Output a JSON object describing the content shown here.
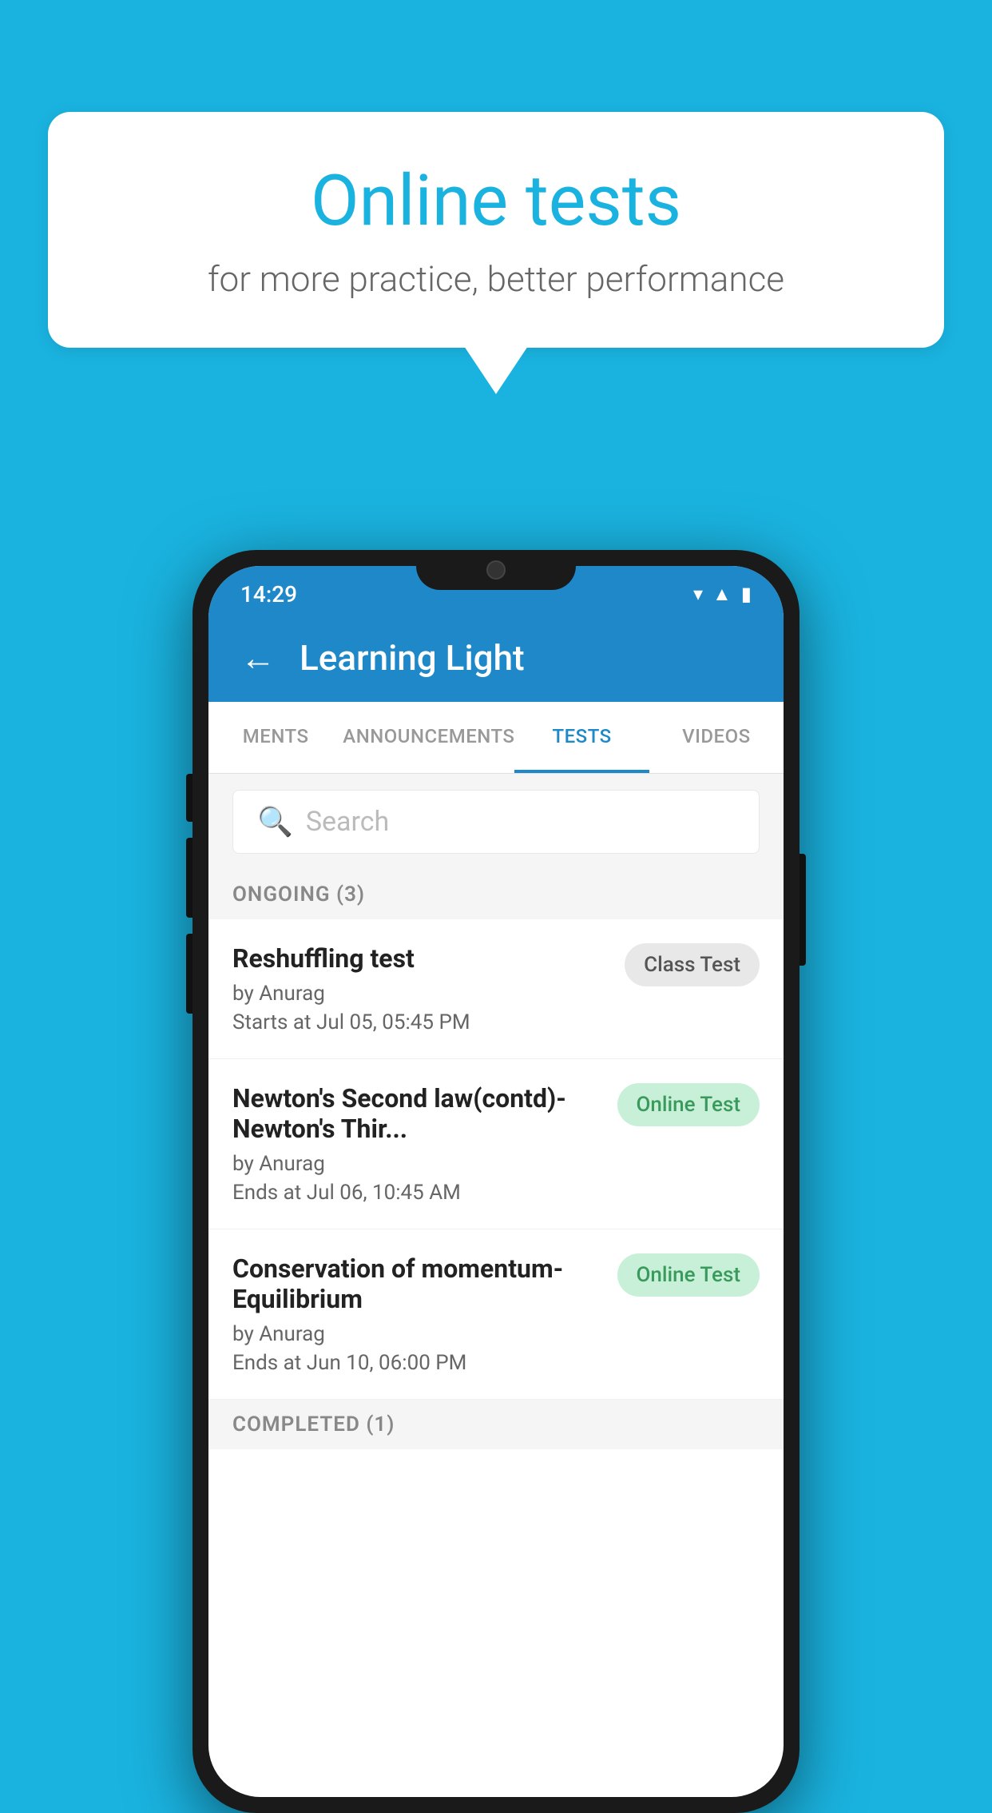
{
  "background_color": "#1ab3e0",
  "bubble": {
    "title": "Online tests",
    "subtitle": "for more practice, better performance"
  },
  "phone": {
    "status_bar": {
      "time": "14:29",
      "icons": [
        "wifi",
        "signal",
        "battery"
      ]
    },
    "header": {
      "title": "Learning Light",
      "back_label": "←"
    },
    "tabs": [
      {
        "label": "MENTS",
        "active": false
      },
      {
        "label": "ANNOUNCEMENTS",
        "active": false
      },
      {
        "label": "TESTS",
        "active": true
      },
      {
        "label": "VIDEOS",
        "active": false
      }
    ],
    "search": {
      "placeholder": "Search"
    },
    "section_ongoing": {
      "label": "ONGOING (3)"
    },
    "tests": [
      {
        "name": "Reshuffling test",
        "author": "by Anurag",
        "date_label": "Starts at",
        "date": "Jul 05, 05:45 PM",
        "badge": "Class Test",
        "badge_type": "class"
      },
      {
        "name": "Newton's Second law(contd)-Newton's Thir...",
        "author": "by Anurag",
        "date_label": "Ends at",
        "date": "Jul 06, 10:45 AM",
        "badge": "Online Test",
        "badge_type": "online"
      },
      {
        "name": "Conservation of momentum-Equilibrium",
        "author": "by Anurag",
        "date_label": "Ends at",
        "date": "Jun 10, 06:00 PM",
        "badge": "Online Test",
        "badge_type": "online"
      }
    ],
    "section_completed": {
      "label": "COMPLETED (1)"
    }
  }
}
